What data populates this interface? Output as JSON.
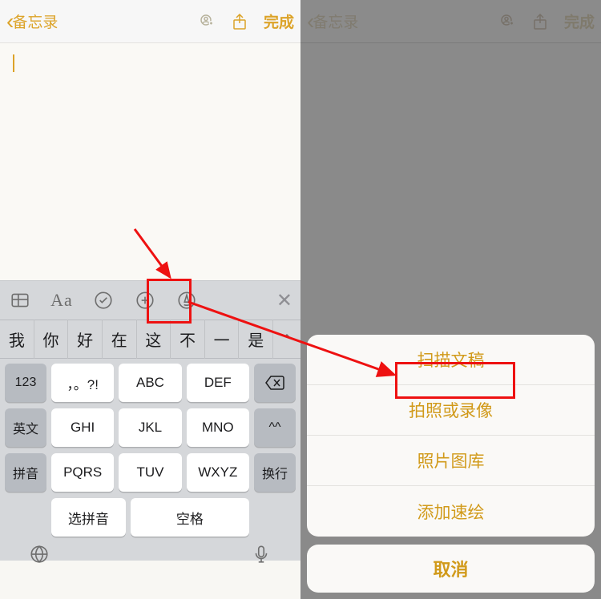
{
  "nav": {
    "back_label": "备忘录",
    "done_label": "完成"
  },
  "format_bar": {
    "aa_label": "Aa"
  },
  "suggestions": [
    "我",
    "你",
    "好",
    "在",
    "这",
    "不",
    "一",
    "是"
  ],
  "keyboard": {
    "row1": [
      "123",
      "，。?!",
      "ABC",
      "DEF"
    ],
    "row2": [
      "英文",
      "GHI",
      "JKL",
      "MNO",
      "^^"
    ],
    "row3": [
      "拼音",
      "PQRS",
      "TUV",
      "WXYZ",
      "换行"
    ],
    "row4_left": "选拼音",
    "row4_space": "空格",
    "delete_icon": "delete-icon"
  },
  "action_sheet": {
    "items": [
      "扫描文稿",
      "拍照或录像",
      "照片图库",
      "添加速绘"
    ],
    "cancel": "取消"
  }
}
